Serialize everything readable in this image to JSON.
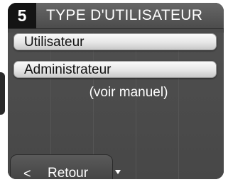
{
  "header": {
    "menu_number": "5",
    "title": "TYPE D'UTILISATEUR"
  },
  "options": [
    {
      "label": "Utilisateur"
    },
    {
      "label": "Administrateur"
    }
  ],
  "note": "(voir manuel)",
  "footer": {
    "back_arrow": "<",
    "back_label": "Retour"
  },
  "colors": {
    "screen_bg": "#4b4b4b",
    "menu_number_bg": "#141414",
    "text": "#ffffff",
    "option_text": "#111111"
  },
  "icons": {
    "back": "chevron-left-icon",
    "scroll": "triangle-down-icon",
    "side_tab": "side-tab"
  }
}
